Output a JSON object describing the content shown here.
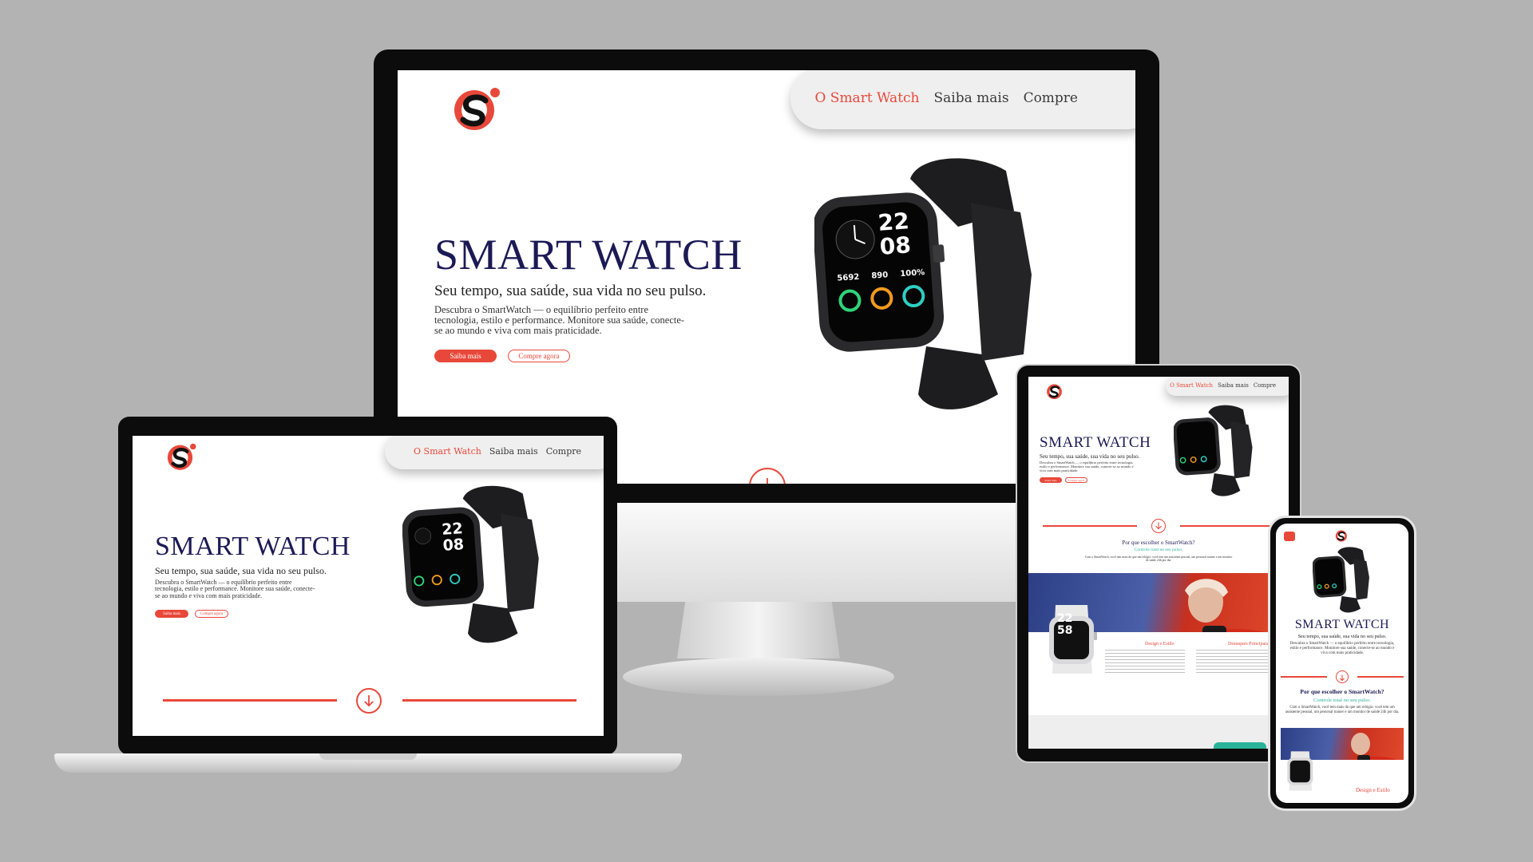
{
  "site": {
    "nav": {
      "item1": "O Smart Watch",
      "item2": "Saiba mais",
      "item3": "Compre"
    },
    "hero": {
      "title": "SMART WATCH",
      "subtitle": "Seu tempo, sua saúde, sua vida no seu pulso.",
      "description": "Descubra o SmartWatch — o equilíbrio perfeito entre tecnologia, estilo e performance. Monitore sua saúde, conecte-se ao mundo e viva com mais praticidade.",
      "btn_primary": "Saiba mais",
      "btn_secondary": "Compre agora"
    },
    "watch": {
      "hour": "22",
      "minute": "08",
      "stat1": "5692",
      "stat2": "890",
      "stat3": "100%"
    },
    "section2": {
      "heading": "Por que escolher o SmartWatch?",
      "subheading": "Controle total no seu pulso.",
      "text": "Com o SmartWatch, você tem mais do que um relógio: você tem um assistente pessoal, um personal trainer e um monitor de saúde 24h por dia."
    },
    "features": {
      "col1_title": "Design e Estilo",
      "col2_title": "Destaques Principais",
      "watch2_hour": "22",
      "watch2_minute": "58"
    }
  },
  "colors": {
    "accent": "#e8483a",
    "title": "#1c1a55",
    "subheading": "#2bb39a",
    "background": "#b3b3b3"
  }
}
